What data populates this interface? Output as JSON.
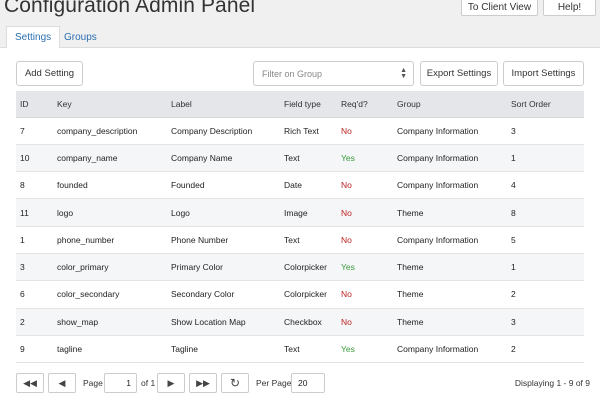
{
  "header": {
    "title": "Configuration Admin Panel",
    "client_view_label": "To Client View",
    "help_label": "Help!"
  },
  "tabs": [
    {
      "label": "Settings",
      "active": true
    },
    {
      "label": "Groups",
      "active": false
    }
  ],
  "toolbar": {
    "add_label": "Add Setting",
    "filter_placeholder": "Filter on Group",
    "export_label": "Export Settings",
    "import_label": "Import Settings"
  },
  "table": {
    "columns": [
      "ID",
      "Key",
      "Label",
      "Field type",
      "Req'd?",
      "Group",
      "Sort Order"
    ],
    "rows": [
      {
        "id": "7",
        "key": "company_description",
        "label": "Company Description",
        "type": "Rich Text",
        "req": "No",
        "group": "Company Information",
        "sort": "3"
      },
      {
        "id": "10",
        "key": "company_name",
        "label": "Company Name",
        "type": "Text",
        "req": "Yes",
        "group": "Company Information",
        "sort": "1"
      },
      {
        "id": "8",
        "key": "founded",
        "label": "Founded",
        "type": "Date",
        "req": "No",
        "group": "Company Information",
        "sort": "4"
      },
      {
        "id": "11",
        "key": "logo",
        "label": "Logo",
        "type": "Image",
        "req": "No",
        "group": "Theme",
        "sort": "8"
      },
      {
        "id": "1",
        "key": "phone_number",
        "label": "Phone Number",
        "type": "Text",
        "req": "No",
        "group": "Company Information",
        "sort": "5"
      },
      {
        "id": "3",
        "key": "color_primary",
        "label": "Primary Color",
        "type": "Colorpicker",
        "req": "Yes",
        "group": "Theme",
        "sort": "1"
      },
      {
        "id": "6",
        "key": "color_secondary",
        "label": "Secondary Color",
        "type": "Colorpicker",
        "req": "No",
        "group": "Theme",
        "sort": "2"
      },
      {
        "id": "2",
        "key": "show_map",
        "label": "Show Location Map",
        "type": "Checkbox",
        "req": "No",
        "group": "Theme",
        "sort": "3"
      },
      {
        "id": "9",
        "key": "tagline",
        "label": "Tagline",
        "type": "Text",
        "req": "Yes",
        "group": "Company Information",
        "sort": "2"
      }
    ]
  },
  "pager": {
    "page_label": "Page",
    "page_value": "1",
    "of_label": "of 1",
    "per_page_label": "Per Page:",
    "per_page_value": "20",
    "display_text": "Displaying 1 - 9 of 9",
    "first_icon": "double-left-arrow-icon",
    "prev_icon": "left-arrow-icon",
    "next_icon": "right-arrow-icon",
    "last_icon": "double-right-arrow-icon",
    "refresh_icon": "refresh-icon"
  },
  "colors": {
    "accent": "#2a6fb0",
    "no": "#bb2222",
    "yes": "#3a9a3a"
  }
}
